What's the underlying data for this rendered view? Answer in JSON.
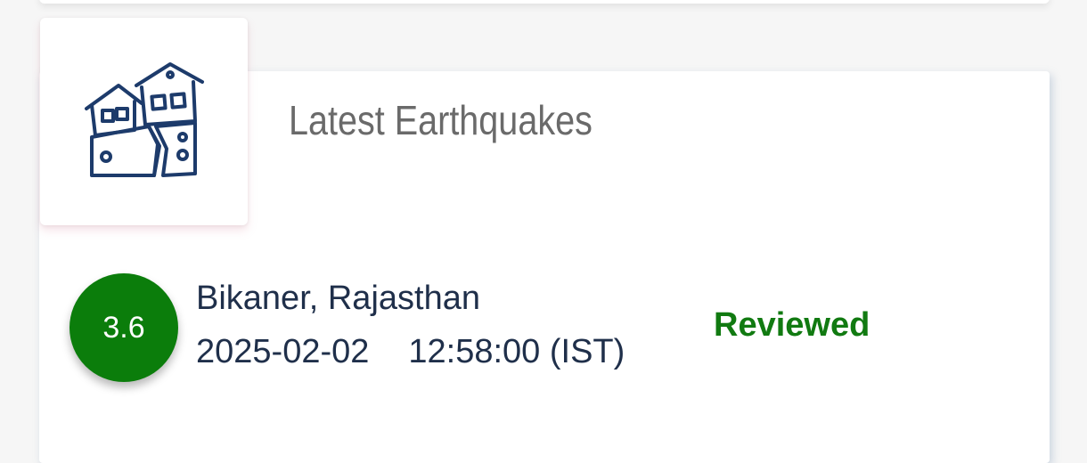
{
  "section": {
    "title": "Latest Earthquakes",
    "icon": "earthquake-houses-icon"
  },
  "quakes": [
    {
      "magnitude": "3.6",
      "location": "Bikaner, Rajasthan",
      "date": "2025-02-02",
      "time": "12:58:00 (IST)",
      "status": "Reviewed"
    }
  ],
  "colors": {
    "magnitude_badge": "#0b7d0b",
    "status_text": "#117a11",
    "icon_stroke": "#1d3b6b",
    "title_text": "#6a6a6a",
    "body_text": "#1f2f4a"
  }
}
